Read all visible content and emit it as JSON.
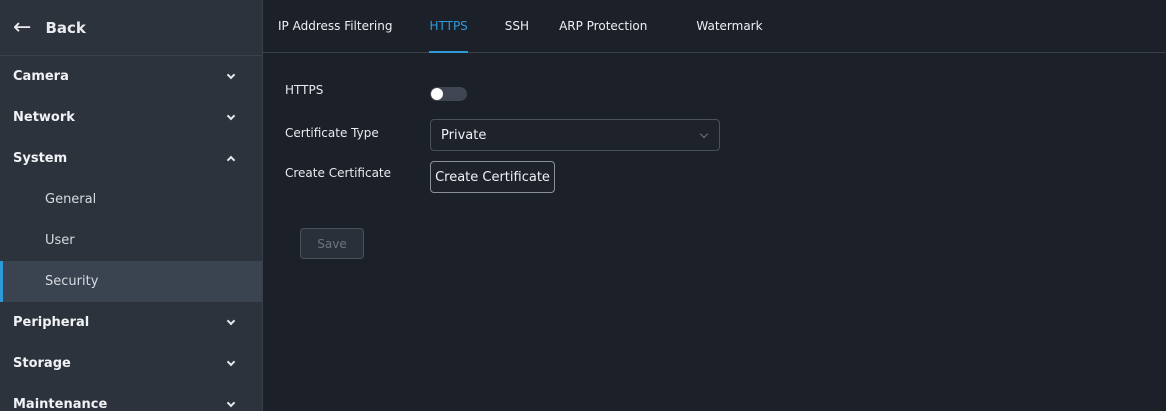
{
  "sidebar": {
    "back_label": "Back",
    "items": [
      {
        "label": "Camera",
        "expanded": false
      },
      {
        "label": "Network",
        "expanded": false
      },
      {
        "label": "System",
        "expanded": true,
        "children": [
          "General",
          "User",
          "Security"
        ],
        "active_child": "Security"
      },
      {
        "label": "Peripheral",
        "expanded": false
      },
      {
        "label": "Storage",
        "expanded": false
      },
      {
        "label": "Maintenance",
        "expanded": false
      }
    ]
  },
  "tabs": [
    {
      "label": "IP Address Filtering",
      "active": false
    },
    {
      "label": "HTTPS",
      "active": true
    },
    {
      "label": "SSH",
      "active": false
    },
    {
      "label": "ARP Protection",
      "active": false
    },
    {
      "label": "Watermark",
      "active": false
    }
  ],
  "form": {
    "https_label": "HTTPS",
    "https_enabled": false,
    "cert_type_label": "Certificate Type",
    "cert_type_value": "Private",
    "create_cert_label": "Create Certificate",
    "create_cert_button": "Create Certificate",
    "save_button": "Save"
  },
  "colors": {
    "accent": "#2f9ad8",
    "sidebar_bg": "#2d333c",
    "main_bg": "#1c2028",
    "active_item_bg": "#3a4350"
  }
}
